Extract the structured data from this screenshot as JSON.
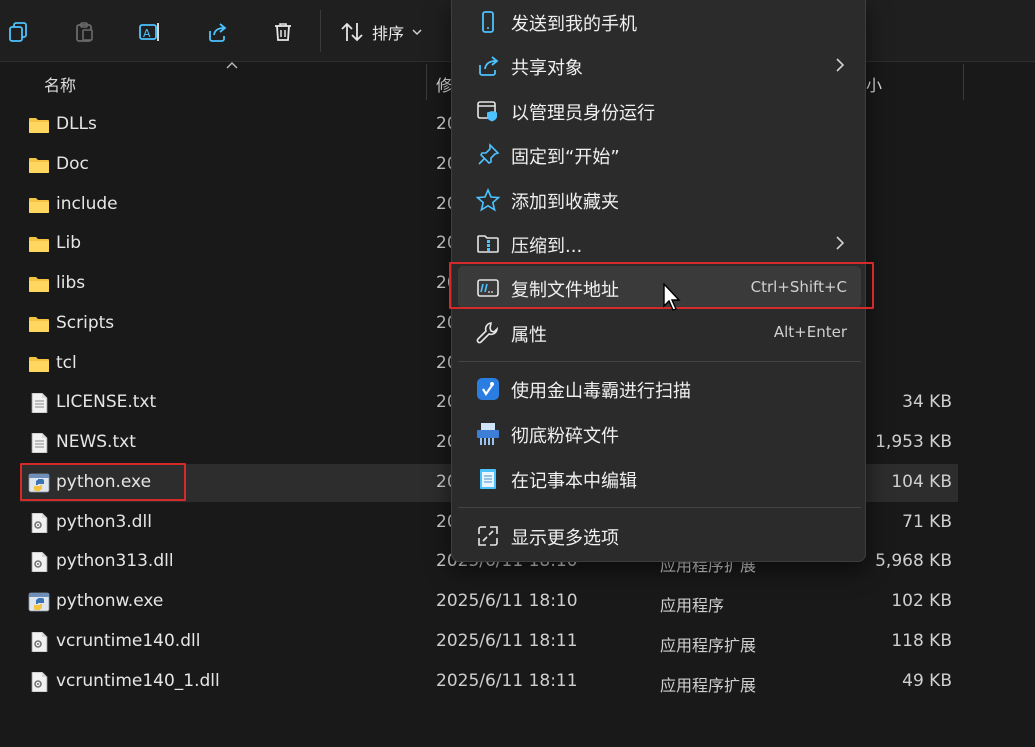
{
  "toolbar": {
    "sort_label": "排序",
    "buttons": [
      "copy-icon",
      "paste-icon",
      "rename-icon",
      "share-icon",
      "delete-icon"
    ]
  },
  "header": {
    "name_col": "名称",
    "date_col": "修",
    "size_col": "小"
  },
  "files": [
    {
      "name": "DLLs",
      "date": "20",
      "type": "",
      "size": "",
      "kind": "folder"
    },
    {
      "name": "Doc",
      "date": "20",
      "type": "",
      "size": "",
      "kind": "folder"
    },
    {
      "name": "include",
      "date": "20",
      "type": "",
      "size": "",
      "kind": "folder"
    },
    {
      "name": "Lib",
      "date": "20",
      "type": "",
      "size": "",
      "kind": "folder"
    },
    {
      "name": "libs",
      "date": "20",
      "type": "",
      "size": "",
      "kind": "folder"
    },
    {
      "name": "Scripts",
      "date": "20",
      "type": "",
      "size": "",
      "kind": "folder"
    },
    {
      "name": "tcl",
      "date": "20",
      "type": "",
      "size": "",
      "kind": "folder"
    },
    {
      "name": "LICENSE.txt",
      "date": "20",
      "type": "",
      "size": "34 KB",
      "kind": "txt"
    },
    {
      "name": "NEWS.txt",
      "date": "20",
      "type": "",
      "size": "1,953 KB",
      "kind": "txt"
    },
    {
      "name": "python.exe",
      "date": "20",
      "type": "",
      "size": "104 KB",
      "kind": "exe"
    },
    {
      "name": "python3.dll",
      "date": "20",
      "type": "",
      "size": "71 KB",
      "kind": "dll"
    },
    {
      "name": "python313.dll",
      "date": "2025/6/11 18:10",
      "type": "应用程序扩展",
      "size": "5,968 KB",
      "kind": "dll"
    },
    {
      "name": "pythonw.exe",
      "date": "2025/6/11 18:10",
      "type": "应用程序",
      "size": "102 KB",
      "kind": "exe"
    },
    {
      "name": "vcruntime140.dll",
      "date": "2025/6/11 18:11",
      "type": "应用程序扩展",
      "size": "118 KB",
      "kind": "dll"
    },
    {
      "name": "vcruntime140_1.dll",
      "date": "2025/6/11 18:11",
      "type": "应用程序扩展",
      "size": "49 KB",
      "kind": "dll"
    }
  ],
  "context_menu": {
    "items": [
      {
        "label": "发送到我的手机",
        "shortcut": "",
        "submenu": false,
        "icon": "phone-icon"
      },
      {
        "label": "共享对象",
        "shortcut": "",
        "submenu": true,
        "icon": "share-icon"
      },
      {
        "label": "以管理员身份运行",
        "shortcut": "",
        "submenu": false,
        "icon": "admin-shield-icon"
      },
      {
        "label": "固定到“开始”",
        "shortcut": "",
        "submenu": false,
        "icon": "pin-icon"
      },
      {
        "label": "添加到收藏夹",
        "shortcut": "",
        "submenu": false,
        "icon": "star-icon"
      },
      {
        "label": "压缩到...",
        "shortcut": "",
        "submenu": true,
        "icon": "zip-icon"
      },
      {
        "label": "复制文件地址",
        "shortcut": "Ctrl+Shift+C",
        "submenu": false,
        "icon": "copy-path-icon"
      },
      {
        "label": "属性",
        "shortcut": "Alt+Enter",
        "submenu": false,
        "icon": "wrench-icon"
      },
      {
        "label": "使用金山毒霸进行扫描",
        "shortcut": "",
        "submenu": false,
        "icon": "antivirus-icon"
      },
      {
        "label": "彻底粉碎文件",
        "shortcut": "",
        "submenu": false,
        "icon": "shredder-icon"
      },
      {
        "label": "在记事本中编辑",
        "shortcut": "",
        "submenu": false,
        "icon": "notepad-icon"
      },
      {
        "label": "显示更多选项",
        "shortcut": "",
        "submenu": false,
        "icon": "more-options-icon"
      }
    ]
  },
  "colors": {
    "highlight_box": "#d42a2a",
    "accent_blue": "#4cc2ff",
    "folder_yellow": "#f6c443"
  }
}
